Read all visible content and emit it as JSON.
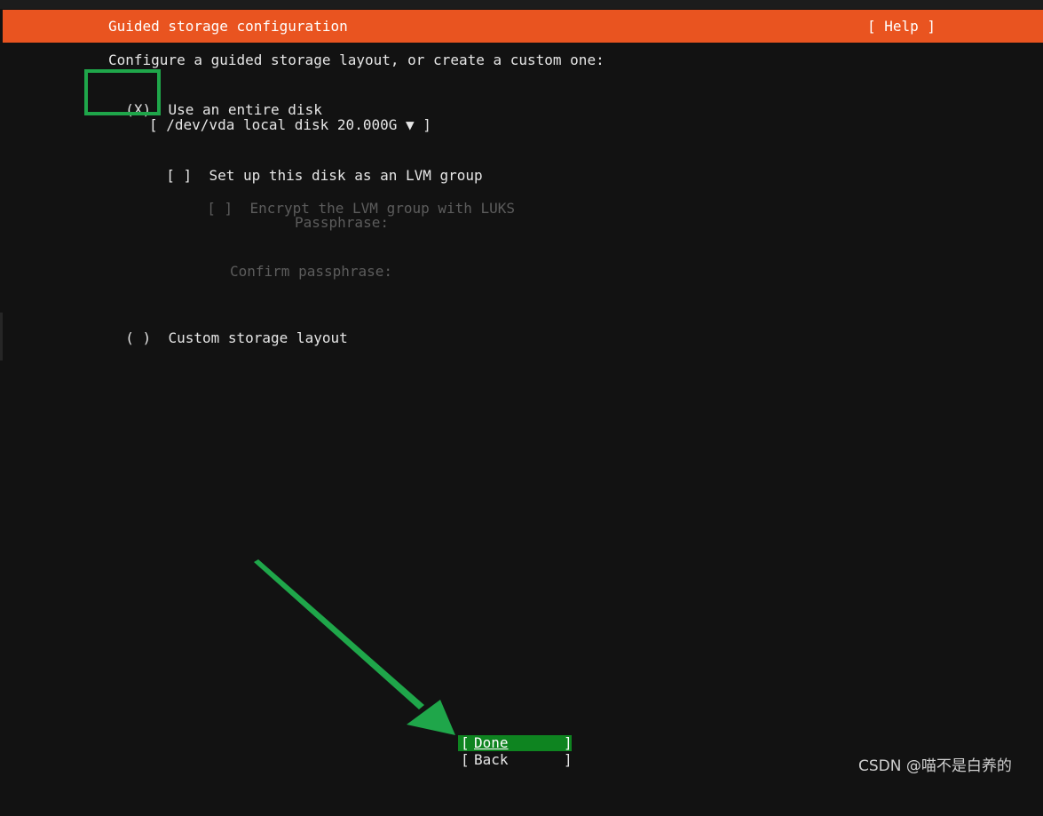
{
  "header": {
    "title": "Guided storage configuration",
    "help": "[ Help ]"
  },
  "intro": "Configure a guided storage layout, or create a custom one:",
  "options": {
    "entire_disk": {
      "radio": "(X)",
      "label": "Use an entire disk",
      "selected": true
    },
    "disk_select": "[ /dev/vda local disk 20.000G ▼ ]",
    "lvm": {
      "checkbox": "[ ]",
      "label": "Set up this disk as an LVM group"
    },
    "encrypt": {
      "checkbox": "[ ]",
      "label": "Encrypt the LVM group with LUKS"
    },
    "passphrase_label": "Passphrase:",
    "confirm_label": "Confirm passphrase:",
    "custom": {
      "radio": "( )",
      "label": "Custom storage layout",
      "selected": false
    }
  },
  "buttons": {
    "done": {
      "open": "[",
      "label": "Done",
      "close": "]"
    },
    "back": {
      "open": "[",
      "label": "Back",
      "close": "]"
    }
  },
  "watermark": "CSDN @喵不是白养的",
  "colors": {
    "header_bg": "#e95420",
    "background": "#121212",
    "done_button_bg": "#0e8420",
    "annotation_green": "#1fa64a",
    "disabled_text": "#5c5c5c"
  }
}
